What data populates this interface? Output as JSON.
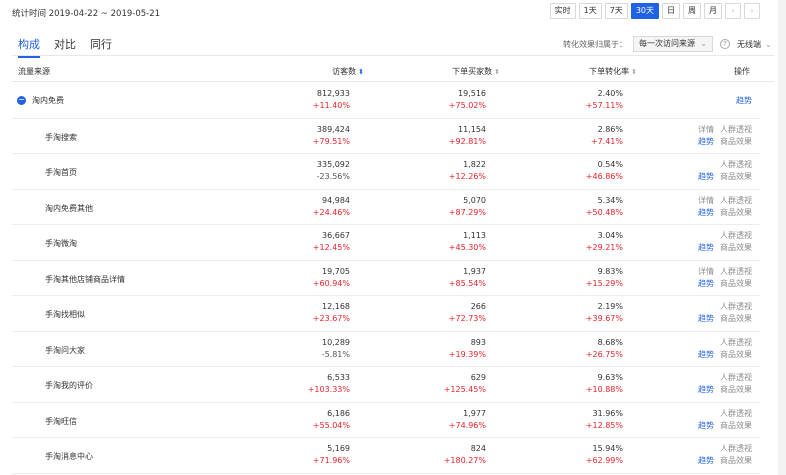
{
  "header": {
    "date_range": "统计时间 2019-04-22 ~ 2019-05-21",
    "periods": [
      {
        "label": "实时",
        "active": false
      },
      {
        "label": "1天",
        "active": false
      },
      {
        "label": "7天",
        "active": false
      },
      {
        "label": "30天",
        "active": true
      },
      {
        "label": "日",
        "active": false
      },
      {
        "label": "周",
        "active": false
      },
      {
        "label": "月",
        "active": false
      }
    ],
    "prev_icon": "chevron-left-icon",
    "next_icon": "chevron-right-icon"
  },
  "tabs": [
    {
      "label": "构成",
      "active": true
    },
    {
      "label": "对比",
      "active": false
    },
    {
      "label": "同行",
      "active": false
    }
  ],
  "attribution": {
    "label": "转化效果归属于：",
    "selected": "每一次访问来源",
    "help_icon": "question-circle-icon",
    "device": "无线端"
  },
  "columns": {
    "source": "流量来源",
    "visitors": "访客数",
    "buyers": "下单买家数",
    "conv": "下单转化率",
    "ops": "操作"
  },
  "colors": {
    "accent": "#2062e6",
    "up": "#e8232b"
  },
  "rows": [
    {
      "name": "淘内免费",
      "level": "parent",
      "visitors": "812,933",
      "visitors_chg": "+11.40%",
      "buyers": "19,516",
      "buyers_chg": "+75.02%",
      "conv": "2.40%",
      "conv_chg": "+57.11%",
      "trend": "趋势"
    },
    {
      "name": "手淘搜索",
      "level": "child",
      "visitors": "389,424",
      "visitors_chg": "+79.51%",
      "buyers": "11,154",
      "buyers_chg": "+92.81%",
      "conv": "2.86%",
      "conv_chg": "+7.41%",
      "detail": "详情",
      "crowd": "人群透视",
      "trend": "趋势",
      "goods": "商品效果"
    },
    {
      "name": "手淘首页",
      "level": "child",
      "visitors": "335,092",
      "visitors_chg": "-23.56%",
      "buyers": "1,822",
      "buyers_chg": "+12.26%",
      "conv": "0.54%",
      "conv_chg": "+46.86%",
      "crowd": "人群透视",
      "trend": "趋势",
      "goods": "商品效果"
    },
    {
      "name": "淘内免费其他",
      "level": "child",
      "visitors": "94,984",
      "visitors_chg": "+24.46%",
      "buyers": "5,070",
      "buyers_chg": "+87.29%",
      "conv": "5.34%",
      "conv_chg": "+50.48%",
      "detail": "详情",
      "crowd": "人群透视",
      "trend": "趋势",
      "goods": "商品效果"
    },
    {
      "name": "手淘微淘",
      "level": "child",
      "visitors": "36,667",
      "visitors_chg": "+12.45%",
      "buyers": "1,113",
      "buyers_chg": "+45.30%",
      "conv": "3.04%",
      "conv_chg": "+29.21%",
      "crowd": "人群透视",
      "trend": "趋势",
      "goods": "商品效果"
    },
    {
      "name": "手淘其他店铺商品详情",
      "level": "child",
      "visitors": "19,705",
      "visitors_chg": "+60.94%",
      "buyers": "1,937",
      "buyers_chg": "+85.54%",
      "conv": "9.83%",
      "conv_chg": "+15.29%",
      "detail": "详情",
      "crowd": "人群透视",
      "trend": "趋势",
      "goods": "商品效果"
    },
    {
      "name": "手淘找相似",
      "level": "child",
      "visitors": "12,168",
      "visitors_chg": "+23.67%",
      "buyers": "266",
      "buyers_chg": "+72.73%",
      "conv": "2.19%",
      "conv_chg": "+39.67%",
      "crowd": "人群透视",
      "trend": "趋势",
      "goods": "商品效果"
    },
    {
      "name": "手淘问大家",
      "level": "child",
      "visitors": "10,289",
      "visitors_chg": "-5.81%",
      "buyers": "893",
      "buyers_chg": "+19.39%",
      "conv": "8.68%",
      "conv_chg": "+26.75%",
      "crowd": "人群透视",
      "trend": "趋势",
      "goods": "商品效果"
    },
    {
      "name": "手淘我的评价",
      "level": "child",
      "visitors": "6,533",
      "visitors_chg": "+103.33%",
      "buyers": "629",
      "buyers_chg": "+125.45%",
      "conv": "9.63%",
      "conv_chg": "+10.88%",
      "crowd": "人群透视",
      "trend": "趋势",
      "goods": "商品效果"
    },
    {
      "name": "手淘旺信",
      "level": "child",
      "visitors": "6,186",
      "visitors_chg": "+55.04%",
      "buyers": "1,977",
      "buyers_chg": "+74.96%",
      "conv": "31.96%",
      "conv_chg": "+12.85%",
      "crowd": "人群透视",
      "trend": "趋势",
      "goods": "商品效果"
    },
    {
      "name": "手淘消息中心",
      "level": "child",
      "visitors": "5,169",
      "visitors_chg": "+71.96%",
      "buyers": "824",
      "buyers_chg": "+180.27%",
      "conv": "15.94%",
      "conv_chg": "+62.99%",
      "crowd": "人群透视",
      "trend": "趋势",
      "goods": "商品效果"
    }
  ]
}
